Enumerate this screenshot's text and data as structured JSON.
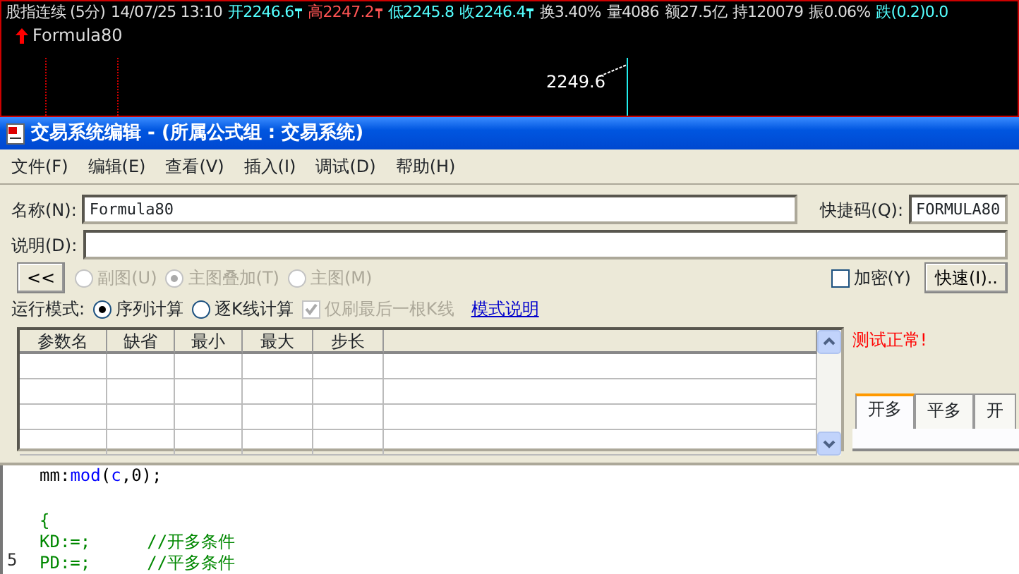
{
  "quote_bar": {
    "items": [
      {
        "text": "股指连续 (5分)",
        "kind": "plain"
      },
      {
        "text": "14/07/25 13:10",
        "kind": "plain"
      },
      {
        "text": "开2246.6",
        "kind": "cyan",
        "mark": true
      },
      {
        "text": "高2247.2",
        "kind": "red",
        "mark": true
      },
      {
        "text": "低2245.8",
        "kind": "cyan"
      },
      {
        "text": "收2246.4",
        "kind": "cyan",
        "mark": true
      },
      {
        "text": "换3.40%",
        "kind": "plain"
      },
      {
        "text": "量4086",
        "kind": "plain"
      },
      {
        "text": "额27.5亿",
        "kind": "plain"
      },
      {
        "text": "持120079",
        "kind": "plain"
      },
      {
        "text": "振0.06%",
        "kind": "plain"
      },
      {
        "text": "跌(0.2)0.0",
        "kind": "cyan"
      }
    ]
  },
  "chart": {
    "indicator": "Formula80",
    "price_label": "2249.6"
  },
  "window": {
    "title": "交易系统编辑 - (所属公式组 : 交易系统)"
  },
  "menu": [
    "文件(F)",
    "编辑(E)",
    "查看(V)",
    "插入(I)",
    "调试(D)",
    "帮助(H)"
  ],
  "name_field": {
    "label": "名称(N):",
    "value": "Formula80"
  },
  "shortcut_field": {
    "label": "快捷码(Q):",
    "value": "FORMULA80"
  },
  "description_field": {
    "label": "说明(D):"
  },
  "collapse_button": "<<",
  "chart_type": [
    {
      "label": "副图(U)",
      "selected": false
    },
    {
      "label": "主图叠加(T)",
      "selected": true
    },
    {
      "label": "主图(M)",
      "selected": false
    }
  ],
  "chart_type_disabled": true,
  "encrypt": {
    "label": "加密(Y)",
    "checked": false
  },
  "quick_button": "快速(I)..",
  "run_mode": {
    "label": "运行模式:",
    "options": [
      {
        "label": "序列计算",
        "selected": true
      },
      {
        "label": "逐K线计算",
        "selected": false
      }
    ],
    "refresh_last": {
      "label": "仅刷最后一根K线",
      "checked": true,
      "disabled": true
    },
    "help_link": "模式说明"
  },
  "params_table": {
    "columns": [
      "参数名",
      "缺省",
      "最小",
      "最大",
      "步长"
    ]
  },
  "status_message": "测试正常!",
  "signal_tabs": [
    {
      "label": "开多",
      "selected": true
    },
    {
      "label": "平多",
      "selected": false
    },
    {
      "label": "开",
      "selected": false
    }
  ],
  "code": [
    {
      "kind": "code",
      "tokens": [
        {
          "text": "mm:",
          "kind": "plain"
        },
        {
          "text": "mod",
          "kind": "func"
        },
        {
          "text": "(",
          "kind": "plain"
        },
        {
          "text": "c",
          "kind": "func"
        },
        {
          "text": ",0);",
          "kind": "plain"
        }
      ]
    },
    {
      "kind": "blank"
    },
    {
      "kind": "code",
      "tokens": [
        {
          "text": "{",
          "kind": "comment"
        }
      ]
    },
    {
      "kind": "code",
      "tokens": [
        {
          "text": "KD:=;",
          "kind": "comment"
        },
        {
          "text": "//开多条件",
          "kind": "comment_tab"
        }
      ]
    },
    {
      "kind": "code",
      "number": "5",
      "tokens": [
        {
          "text": "PD:=;",
          "kind": "comment"
        },
        {
          "text": "//平多条件",
          "kind": "comment_tab"
        }
      ]
    }
  ]
}
